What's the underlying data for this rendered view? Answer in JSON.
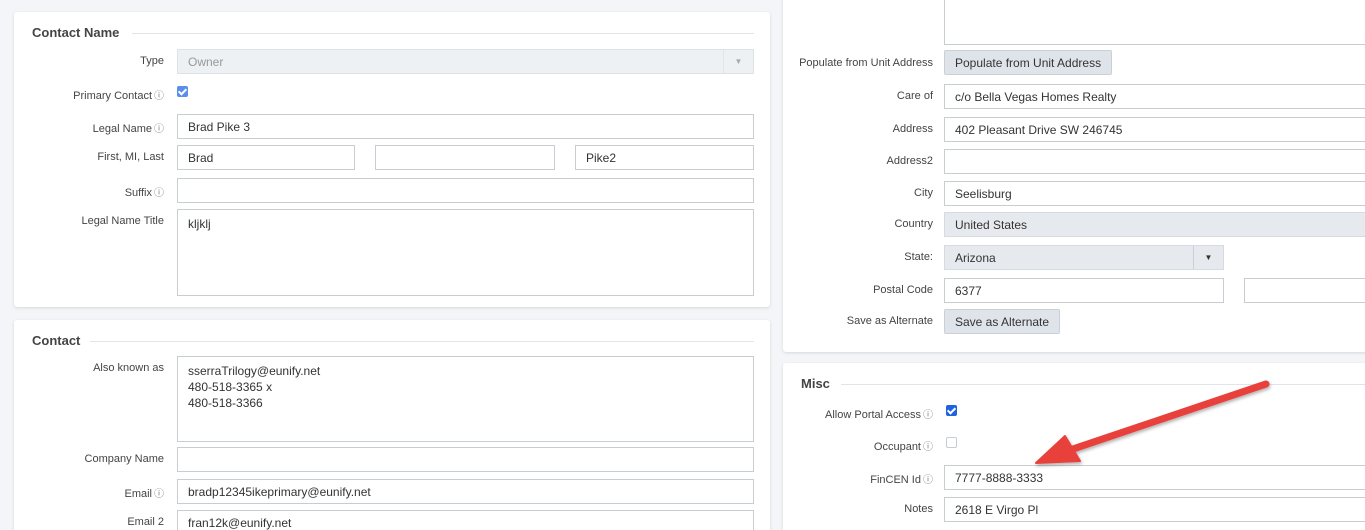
{
  "contact_name": {
    "title": "Contact Name",
    "type": {
      "label": "Type",
      "value": "Owner"
    },
    "primary_contact": {
      "label": "Primary Contact",
      "info": "ⓘ",
      "checked": true
    },
    "legal_name": {
      "label": "Legal Name",
      "info": "ⓘ",
      "value": "Brad Pike 3"
    },
    "first_mi_last": {
      "label": "First, MI, Last",
      "first": "Brad",
      "mi": "",
      "last": "Pike2"
    },
    "suffix": {
      "label": "Suffix",
      "info": "ⓘ",
      "value": ""
    },
    "legal_name_title": {
      "label": "Legal Name Title",
      "value": "kljklj"
    }
  },
  "contact": {
    "title": "Contact",
    "also_known_as": {
      "label": "Also known as",
      "value": "sserraTrilogy@eunify.net\n480-518-3365 x\n480-518-3366"
    },
    "company_name": {
      "label": "Company Name",
      "value": ""
    },
    "email": {
      "label": "Email",
      "info": "ⓘ",
      "value": "bradp12345ikeprimary@eunify.net"
    },
    "email2": {
      "label": "Email 2",
      "value": "fran12k@eunify.net"
    }
  },
  "address": {
    "populate": {
      "label": "Populate from Unit Address",
      "button": "Populate from Unit Address"
    },
    "care_of": {
      "label": "Care of",
      "value": "c/o Bella Vegas Homes Realty"
    },
    "address1": {
      "label": "Address",
      "value": "402 Pleasant Drive SW 246745"
    },
    "address2": {
      "label": "Address2",
      "value": ""
    },
    "city": {
      "label": "City",
      "value": "Seelisburg"
    },
    "country": {
      "label": "Country",
      "value": "United States"
    },
    "state": {
      "label": "State:",
      "value": "Arizona"
    },
    "postal_code": {
      "label": "Postal Code",
      "value": "6377",
      "ext": ""
    },
    "save_alternate": {
      "label": "Save as Alternate",
      "button": "Save as Alternate"
    }
  },
  "misc": {
    "title": "Misc",
    "allow_portal_access": {
      "label": "Allow Portal Access",
      "info": "ⓘ",
      "checked": true
    },
    "occupant": {
      "label": "Occupant",
      "info": "ⓘ",
      "checked": false
    },
    "fincen_id": {
      "label": "FinCEN Id",
      "info": "ⓘ",
      "value": "7777-8888-3333"
    },
    "notes": {
      "label": "Notes",
      "value": "2618 E Virgo Pl"
    }
  },
  "annotation": {
    "color": "#e8403a",
    "icon": "red-arrow-annotation"
  },
  "colors": {
    "accent": "#1f63e0",
    "button_bg": "#dfe4ea",
    "panel_bg": "#ffffff",
    "page_bg": "#f3f5f8"
  }
}
